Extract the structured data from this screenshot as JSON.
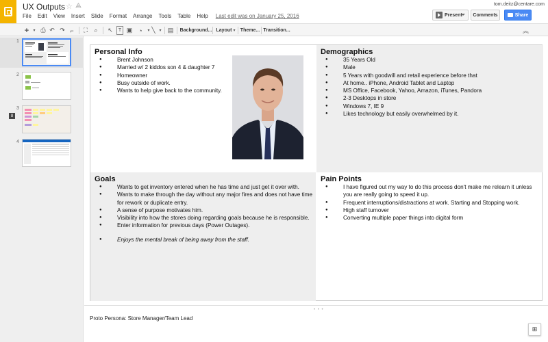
{
  "app": {
    "title": "UX Outputs",
    "user_email": "tom.deitz@centare.com",
    "last_edit": "Last edit was on January 25, 2016",
    "star_icon": "star-icon",
    "drive_icon": "drive-icon"
  },
  "menu": [
    "File",
    "Edit",
    "View",
    "Insert",
    "Slide",
    "Format",
    "Arrange",
    "Tools",
    "Table",
    "Help"
  ],
  "actions": {
    "present": "Present",
    "comments": "Comments",
    "share": "Share"
  },
  "toolbar": {
    "add": "+",
    "background": "Background...",
    "layout": "Layout",
    "theme": "Theme...",
    "transition": "Transition..."
  },
  "filmstrip": {
    "slides": [
      {
        "number": "1"
      },
      {
        "number": "2"
      },
      {
        "number": "3"
      },
      {
        "number": "4"
      }
    ],
    "badge": "8"
  },
  "slide": {
    "personal_info": {
      "title": "Personal Info",
      "items": [
        "Brent Johnson",
        "Married w/ 2 kiddos son 4 & daughter 7",
        "Homeowner",
        "Busy outside of work.",
        "Wants to help give back to the community."
      ]
    },
    "demographics": {
      "title": "Demographics",
      "items": [
        "35 Years Old",
        "Male",
        "5 Years with goodwill and retail experience before that",
        "At home.. iPhone, Android Tablet and Laptop",
        "MS Office, Facebook, Yahoo, Amazon, iTunes, Pandora",
        "2-3 Desktops in store",
        "Windows 7, IE 9",
        "Likes technology but easily overwhelmed by it."
      ]
    },
    "goals": {
      "title": "Goals",
      "items": [
        "Wants to get inventory entered when he has time and just get it over with.",
        "Wants to make through the day without any major fires and does not have time for rework or duplicate entry.",
        "A sense of purpose motivates him.",
        "Visibility into how the stores doing regarding goals because he is responsible.",
        "Enter information for previous days (Power Outages).",
        "Enjoys the mental break of being away from the staff."
      ]
    },
    "pain_points": {
      "title": "Pain Points",
      "items": [
        "I have figured out my way to do this process don't make me relearn it unless you are really going to speed it up.",
        "Frequent interruptions/distractions at work. Starting and Stopping work.",
        "High staff turnover",
        "Converting multiple paper things into digital form"
      ]
    }
  },
  "notes": {
    "text": "Proto Persona: Store Manager/Team Lead"
  },
  "colors": {
    "logo": "#f4b400",
    "share": "#4a8af4",
    "quad_gray": "#eeeeee"
  }
}
